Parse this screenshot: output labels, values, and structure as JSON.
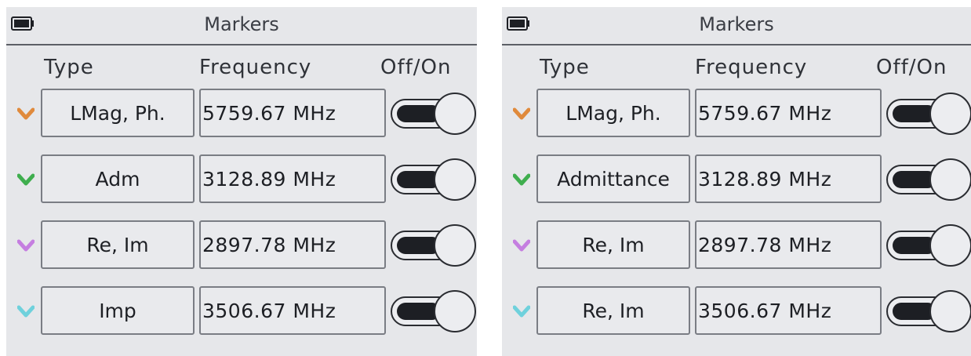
{
  "screens": [
    {
      "title": "Markers",
      "columns": {
        "type": "Type",
        "frequency": "Frequency",
        "toggle": "Off/On"
      },
      "rows": [
        {
          "marker_color": "#e08a3c",
          "type": "LMag, Ph.",
          "frequency": "5759.67 MHz",
          "on": true
        },
        {
          "marker_color": "#3fae4e",
          "type": "Adm",
          "frequency": "3128.89 MHz",
          "on": true
        },
        {
          "marker_color": "#c57ee0",
          "type": "Re, Im",
          "frequency": "2897.78 MHz",
          "on": true
        },
        {
          "marker_color": "#6fd1dc",
          "type": "Imp",
          "frequency": "3506.67 MHz",
          "on": true
        }
      ]
    },
    {
      "title": "Markers",
      "columns": {
        "type": "Type",
        "frequency": "Frequency",
        "toggle": "Off/On"
      },
      "rows": [
        {
          "marker_color": "#e08a3c",
          "type": "LMag, Ph.",
          "frequency": "5759.67 MHz",
          "on": true
        },
        {
          "marker_color": "#3fae4e",
          "type": "Admittance",
          "frequency": "3128.89 MHz",
          "on": true
        },
        {
          "marker_color": "#c57ee0",
          "type": "Re, Im",
          "frequency": "2897.78 MHz",
          "on": true
        },
        {
          "marker_color": "#6fd1dc",
          "type": "Re, Im",
          "frequency": "3506.67 MHz",
          "on": true
        }
      ]
    }
  ],
  "icons": {
    "battery": "battery-icon",
    "marker": "marker-chevron-icon",
    "toggle": "toggle-switch"
  }
}
